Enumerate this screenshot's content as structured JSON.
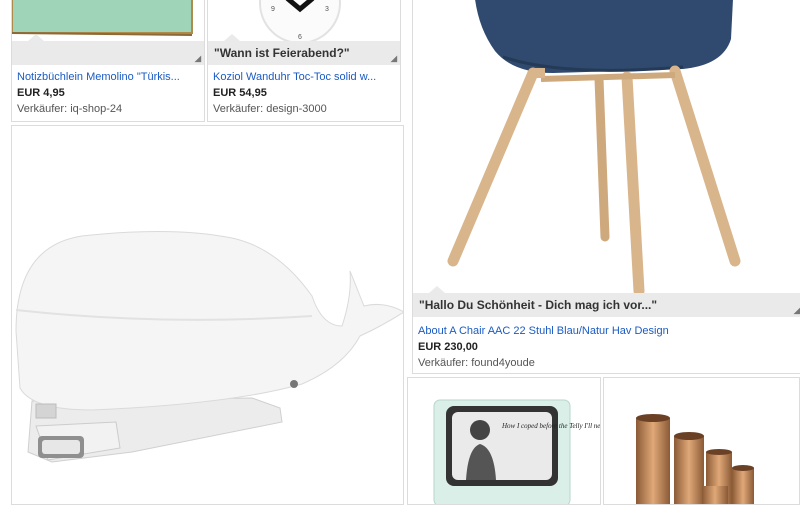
{
  "items": [
    {
      "caption": "",
      "title": "Notizbüchlein Memolino \"Türkis...",
      "price": "EUR 4,95",
      "seller": "Verkäufer: iq-shop-24"
    },
    {
      "caption": "\"Wann ist Feierabend?\"",
      "title": "Koziol Wanduhr Toc-Toc solid w...",
      "price": "EUR 54,95",
      "seller": "Verkäufer: design-3000"
    },
    {
      "caption": "\"Hallo Du Schönheit - Dich mag ich vor...\"",
      "title": "About A Chair AAC 22 Stuhl Blau/Natur Hav Design",
      "price": "EUR 230,00",
      "seller": "Verkäufer: found4youde"
    }
  ],
  "tv_text": "How I coped before the Telly I'll never know",
  "clock_numbers": [
    "9",
    "6",
    "3"
  ],
  "colors": {
    "link": "#1a5bc4",
    "caption_bg": "#eaeaea",
    "chair_seat": "#2f4a6e",
    "wood": "#d9b58c",
    "copper": "#c58b5e"
  }
}
